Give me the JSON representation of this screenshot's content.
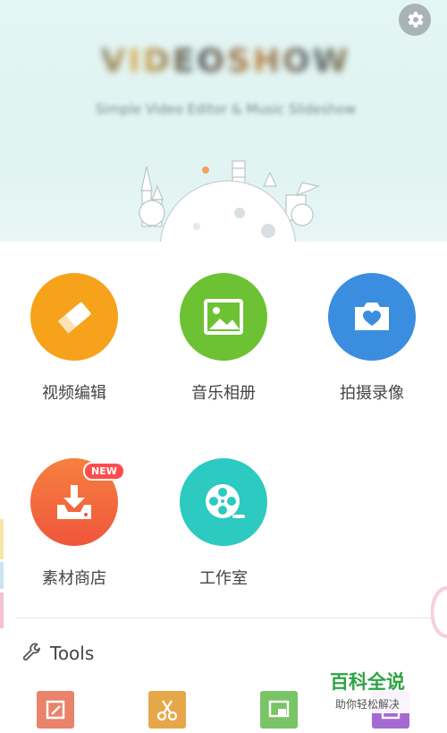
{
  "header": {
    "logo_text": "VIDEOSHOW",
    "tagline": "Simple Video Editor & Music Slideshow"
  },
  "features": [
    {
      "label": "视频编辑",
      "icon": "eraser-icon",
      "color": "#f7a21b"
    },
    {
      "label": "音乐相册",
      "icon": "image-icon",
      "color": "#6cc233"
    },
    {
      "label": "拍摄录像",
      "icon": "camera-heart-icon",
      "color": "#3b8de0"
    },
    {
      "label": "素材商店",
      "icon": "download-tray-icon",
      "color": "#f4603e",
      "badge": "NEW"
    },
    {
      "label": "工作室",
      "icon": "film-reel-icon",
      "color": "#2ccac0"
    }
  ],
  "tools": {
    "title": "Tools",
    "items": [
      {
        "icon": "crop-icon",
        "color": "#e9836b"
      },
      {
        "icon": "scissors-icon",
        "color": "#e6a74a"
      },
      {
        "icon": "compress-icon",
        "color": "#79c466"
      },
      {
        "icon": "square-icon",
        "color": "#a46ad1"
      }
    ]
  },
  "watermark": {
    "main": "百科全说",
    "sub": "助你轻松解决"
  }
}
